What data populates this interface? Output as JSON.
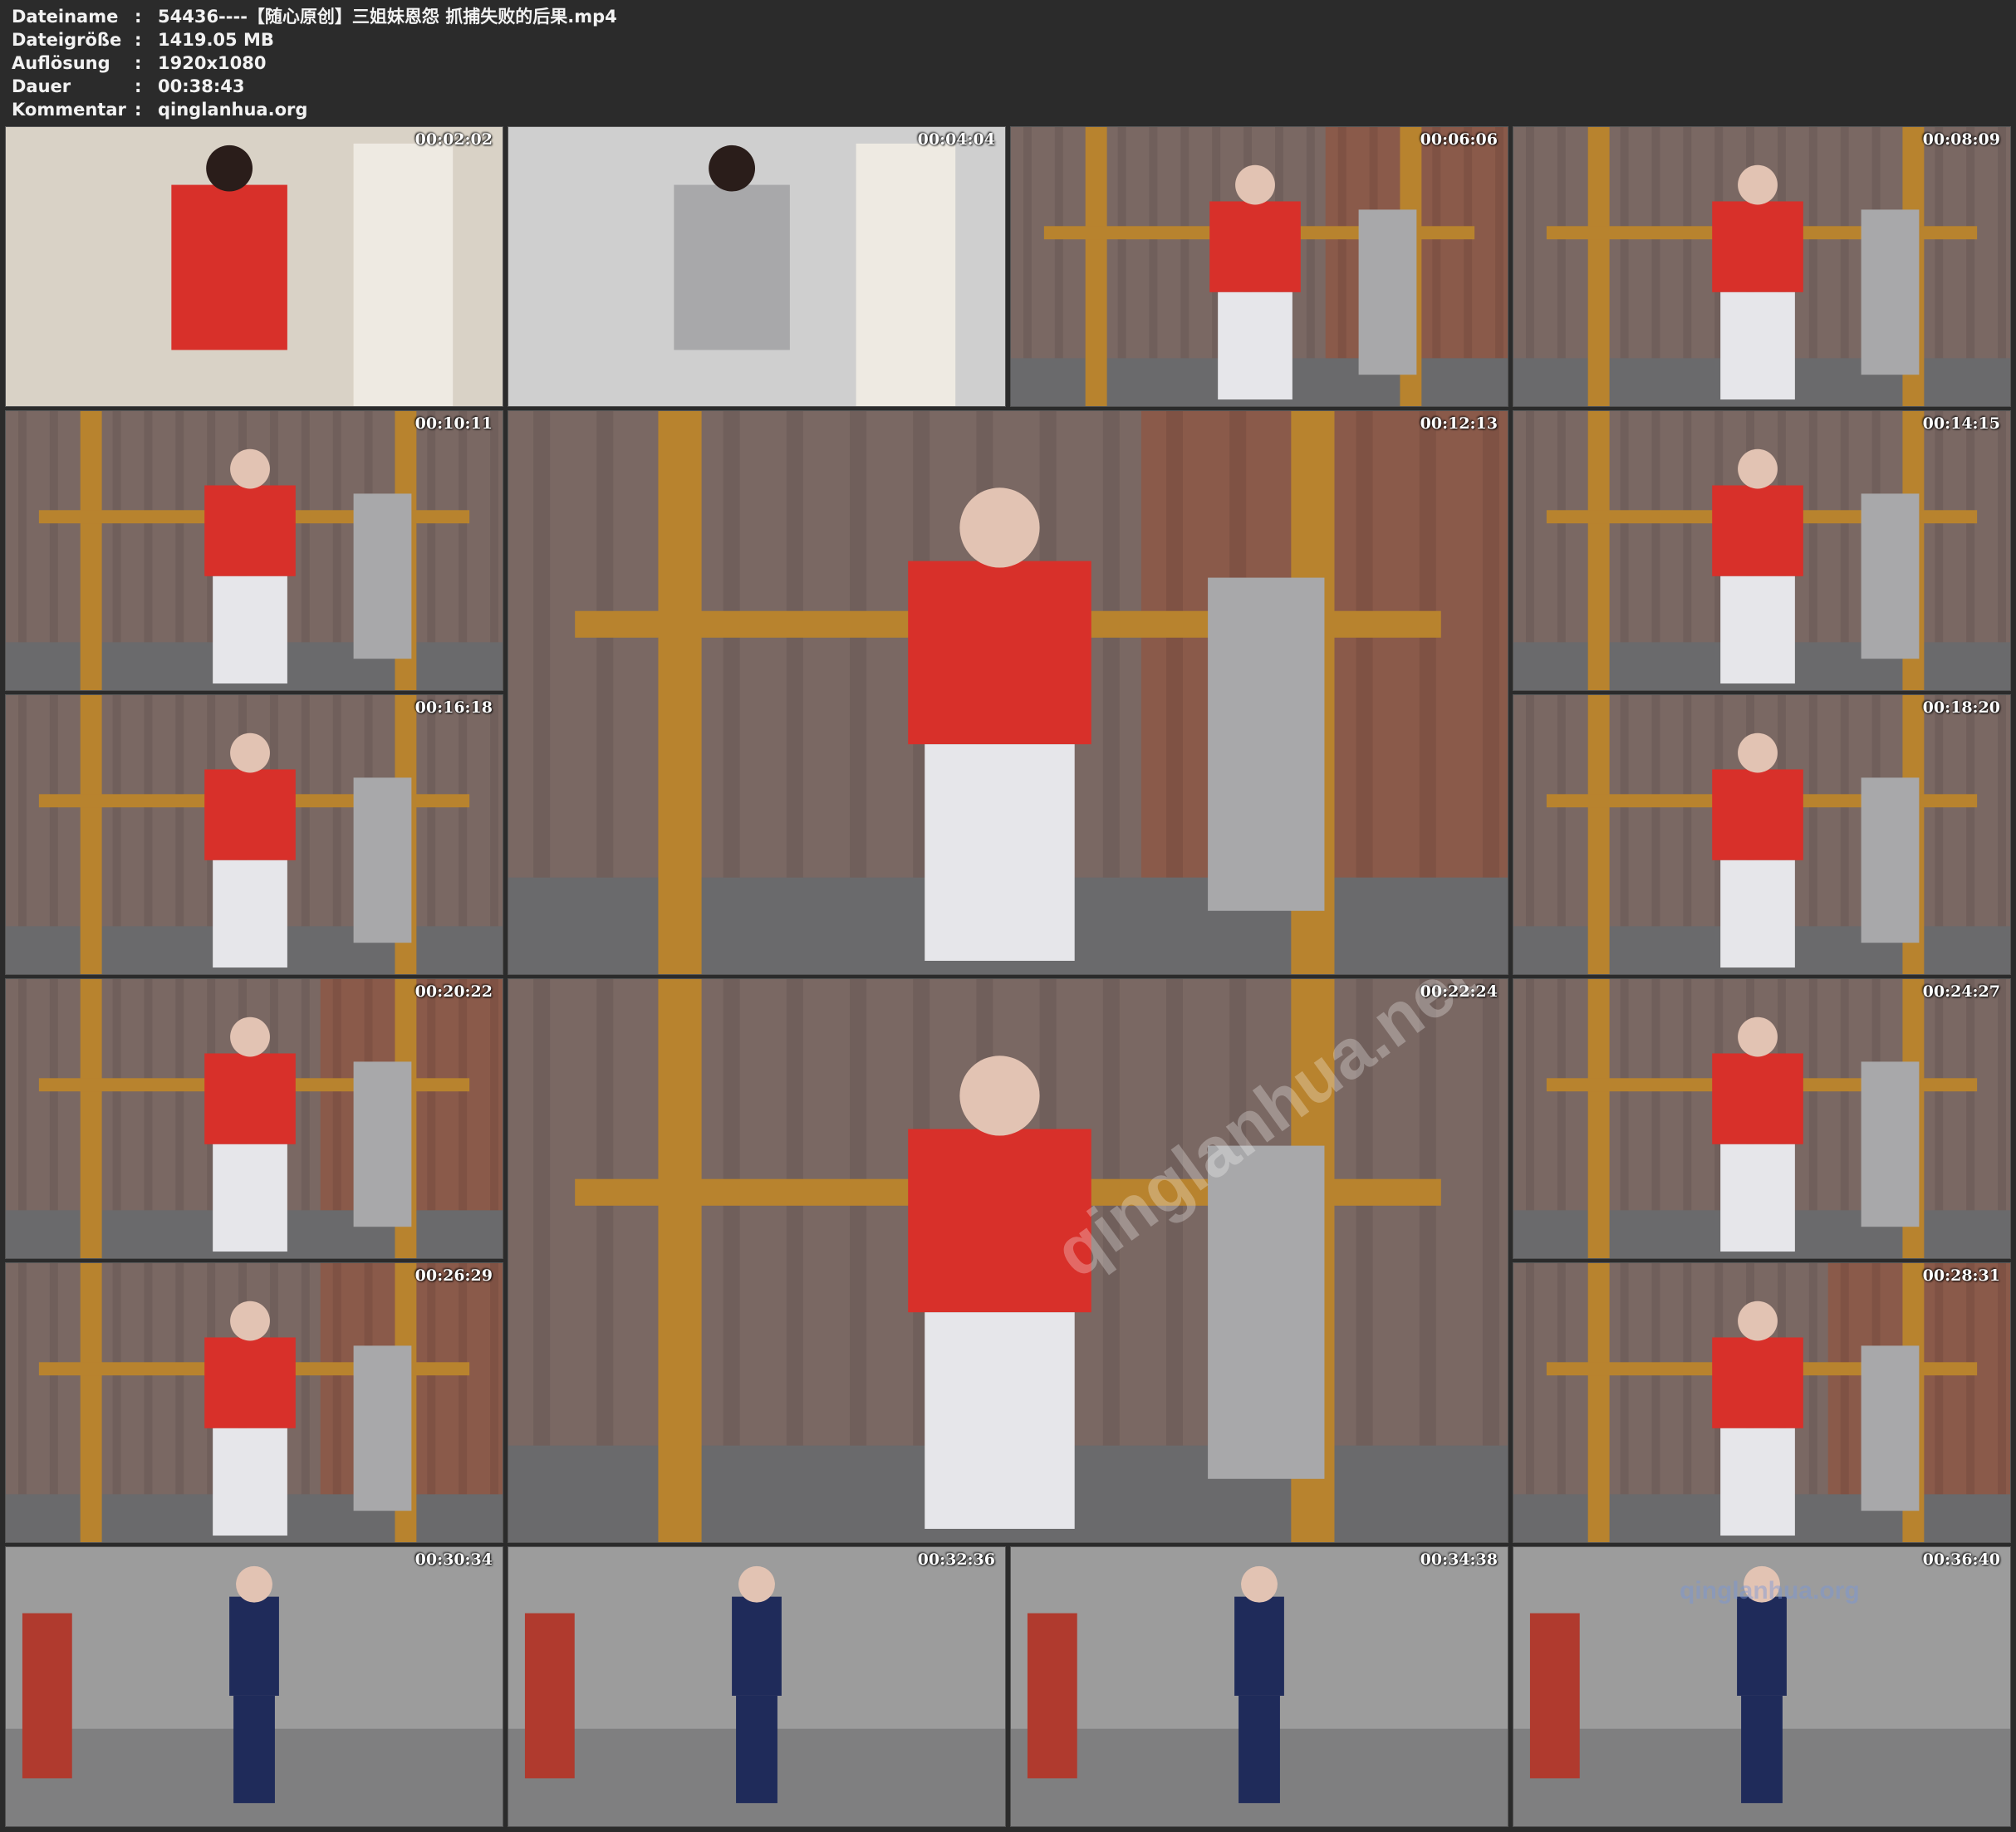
{
  "header": {
    "rows": [
      {
        "label": "Dateiname",
        "sep": ":",
        "value": "54436----【随心原创】三姐妹恩怨 抓捕失败的后果.mp4"
      },
      {
        "label": "Dateigröße",
        "sep": ":",
        "value": "1419.05 MB"
      },
      {
        "label": "Auflösung",
        "sep": ":",
        "value": "1920x1080"
      },
      {
        "label": "Dauer",
        "sep": ":",
        "value": "00:38:43"
      },
      {
        "label": "Kommentar",
        "sep": ":",
        "value": "qinglanhua.org"
      }
    ]
  },
  "thumbnails": [
    {
      "time": "00:02:02",
      "scene": "door"
    },
    {
      "time": "00:04:04",
      "scene": "wall"
    },
    {
      "time": "00:06:06",
      "scene": "brick"
    },
    {
      "time": "00:08:09",
      "scene": "cross"
    },
    {
      "time": "00:10:11",
      "scene": "cross"
    },
    {
      "time": "00:12:13",
      "scene": "brick"
    },
    {
      "time": "00:14:15",
      "scene": "cross"
    },
    {
      "time": "00:16:18",
      "scene": "cross"
    },
    {
      "time": "00:18:20",
      "scene": "cross"
    },
    {
      "time": "00:20:22",
      "scene": "brick"
    },
    {
      "time": "00:22:24",
      "scene": "cross"
    },
    {
      "time": "00:24:27",
      "scene": "cross"
    },
    {
      "time": "00:26:29",
      "scene": "brick"
    },
    {
      "time": "00:28:31",
      "scene": "brick"
    },
    {
      "time": "00:30:34",
      "scene": "studio"
    },
    {
      "time": "00:32:36",
      "scene": "studio"
    },
    {
      "time": "00:34:38",
      "scene": "studio"
    },
    {
      "time": "00:36:40",
      "scene": "studio"
    }
  ],
  "watermarks": {
    "large": "qinglanhua.net",
    "corner": "qinglanhua.org"
  },
  "colors": {
    "background": "#2b2b2b",
    "text": "#f2f2f2",
    "curtain": "#7a6863",
    "brick": "#8a5a4a",
    "wood": "#b8832e",
    "shirt_red": "#d8302a",
    "pants_white": "#e6e6ea",
    "hoodie_grey": "#a8a8aa",
    "uniform_navy": "#1f2b5a",
    "studio_grey": "#9c9c9c"
  }
}
